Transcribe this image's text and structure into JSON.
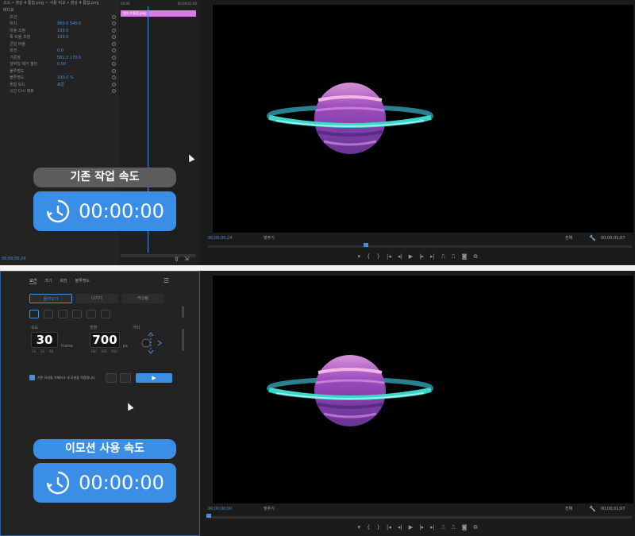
{
  "top": {
    "effect_controls": {
      "header": "소스 • 영상 4 통합.png  ~  사용 비교 • 영상 4 통합.png",
      "section": "비디오",
      "rows": [
        {
          "label": "모션",
          "value": ""
        },
        {
          "label": "위치",
          "value": "960.0   540.0"
        },
        {
          "label": "비율 조정",
          "value": "100.0"
        },
        {
          "label": "폭 비율 조정",
          "value": "100.0"
        },
        {
          "label": "균일 비율",
          "value": ""
        },
        {
          "label": "회전",
          "value": "0.0"
        },
        {
          "label": "기준점",
          "value": "581.0   170.0"
        },
        {
          "label": "깜박임 제거 필터",
          "value": "0.00"
        },
        {
          "label": "불투명도",
          "value": ""
        },
        {
          "label": "불투명도",
          "value": "100.0 %"
        },
        {
          "label": "혼합 모드",
          "value": "표준"
        },
        {
          "label": "시간 다시 매핑",
          "value": ""
        }
      ],
      "footer_timecode": "00;00;00;24"
    },
    "timeline": {
      "ruler_left": "00;00",
      "ruler_right": "00;00;01;00",
      "clip_label": "영상 4 통합.png"
    },
    "monitor": {
      "timecode_left": "00;00;00;24",
      "fit_label": "맞추기",
      "quality_label": "전체",
      "timecode_right": "00;00;01;07"
    },
    "badge_label": "기존 작업 속도",
    "timer": "00:00:00"
  },
  "bottom": {
    "tabs": [
      "모션",
      "크기",
      "회전",
      "불투명도"
    ],
    "segment_buttons": [
      "들어오기",
      "나가기",
      "커스텀"
    ],
    "speed_label": "속도",
    "speed_value": "30",
    "speed_unit": "frame",
    "speed_presets": [
      "10",
      "30",
      "60"
    ],
    "distance_label": "방향",
    "distance_value": "700",
    "distance_unit": "px",
    "distance_presets": [
      "100",
      "300",
      "500"
    ],
    "direction_label": "거리",
    "checkbox_label": "기존 모션을 삭제하고 새 모션을 적용합니다.",
    "play_label": "▶",
    "monitor": {
      "timecode_left": "00;00;00;00",
      "fit_label": "맞추기",
      "quality_label": "전체",
      "timecode_right": "00;00;01;07"
    },
    "badge_label": "이모션 사용 속도",
    "timer": "00:00:00"
  },
  "colors": {
    "accent_blue": "#3a8ee6",
    "badge_gray": "#5c5c5c",
    "clip_pink": "#d77ce0",
    "planet_purple": "#8a3fb0",
    "ring_cyan": "#3dd6c8"
  }
}
